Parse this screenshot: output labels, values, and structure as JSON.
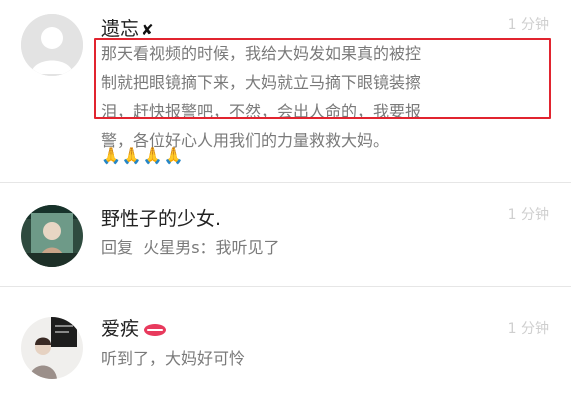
{
  "comments": [
    {
      "user": "遗忘",
      "user_mark": "✘",
      "time": "1 分钟",
      "lines": [
        "那天看视频的时候，我给大妈发如果真的被控",
        "制就把眼镜摘下来，大妈就立马摘下眼镜装擦",
        "泪，赶快报警吧，不然，会出人命的，我要报",
        "警，各位好心人用我们的力量救救大妈。"
      ],
      "emoji": "🙏🙏🙏🙏",
      "avatar_icon": "default-avatar-icon"
    },
    {
      "user": "野性子的少女.",
      "time": "1 分钟",
      "reply_prefix": "回复",
      "reply_to": "火星男s",
      "text": "：我听见了",
      "avatar_icon": "photo-avatar"
    },
    {
      "user": "爱疾",
      "time": "1 分钟",
      "text": "听到了，大妈好可怜",
      "avatar_icon": "photo-avatar",
      "name_emoji": "lips-icon"
    }
  ],
  "colors": {
    "highlight": "#e1242f",
    "divider": "#e6e6e6",
    "time": "#cfcfcf"
  }
}
